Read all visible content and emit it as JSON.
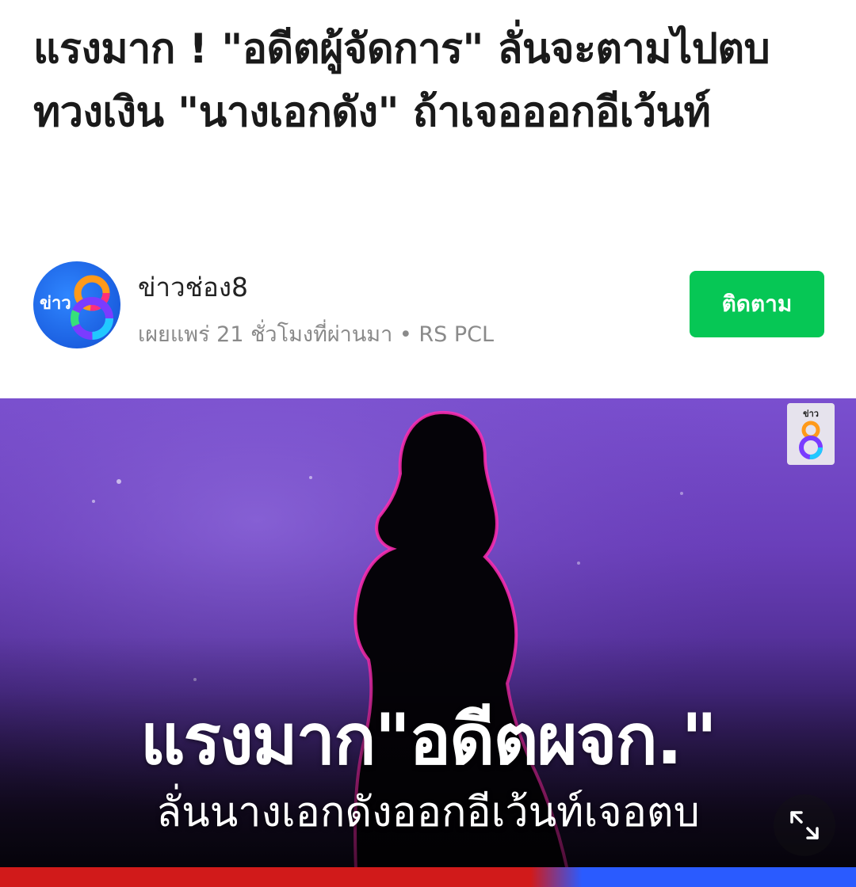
{
  "article": {
    "headline": "แรงมาก ! \"อดีตผู้จัดการ\" ลั่นจะตามไปตบ ทวงเงิน \"นางเอกดัง\" ถ้าเจอออกอีเว้นท์"
  },
  "publisher": {
    "avatar_text": "ข่าว",
    "avatar_number": "8",
    "name": "ข่าวช่อง8",
    "meta": "เผยแพร่ 21 ชั่วโมงที่ผ่านมา • RS PCL",
    "follow_label": "ติดตาม"
  },
  "hero": {
    "title": "แรงมาก\"อดีตผจก.\"",
    "subtitle": "ลั่นนางเอกดังออกอีเว้นท์เจอตบ",
    "badge_text": "ข่าว",
    "badge_number": "8"
  },
  "colors": {
    "follow_button": "#06c755",
    "avatar_blue": "#1b5fe0",
    "hero_purple": "#6a3fba",
    "stripe_red": "#d11a1a",
    "stripe_blue": "#2a5bff"
  },
  "icons": {
    "expand": "expand-icon"
  }
}
